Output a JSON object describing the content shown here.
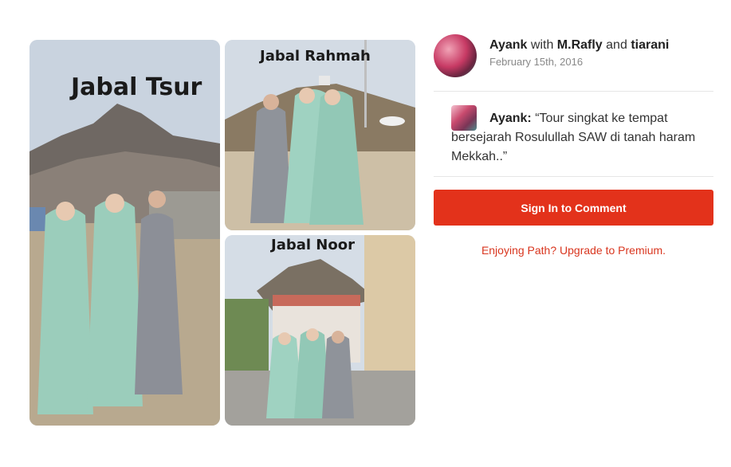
{
  "collage": {
    "photos": [
      {
        "caption": "Jabal Tsur"
      },
      {
        "caption": "Jabal Rahmah"
      },
      {
        "caption": "Jabal Noor"
      }
    ]
  },
  "moment": {
    "author": "Ayank",
    "with_word": "with",
    "tagged_1": "M.Rafly",
    "and_word": "and",
    "tagged_2": "tiarani",
    "date": "February 15th, 2016"
  },
  "comment": {
    "author": "Ayank:",
    "text": "“Tour singkat ke tempat bersejarah Rosulullah SAW di tanah haram Mekkah..”"
  },
  "actions": {
    "sign_in_label": "Sign In to Comment",
    "upgrade_label": "Enjoying Path? Upgrade to Premium."
  },
  "colors": {
    "accent": "#e3321b",
    "link": "#d9361f"
  }
}
